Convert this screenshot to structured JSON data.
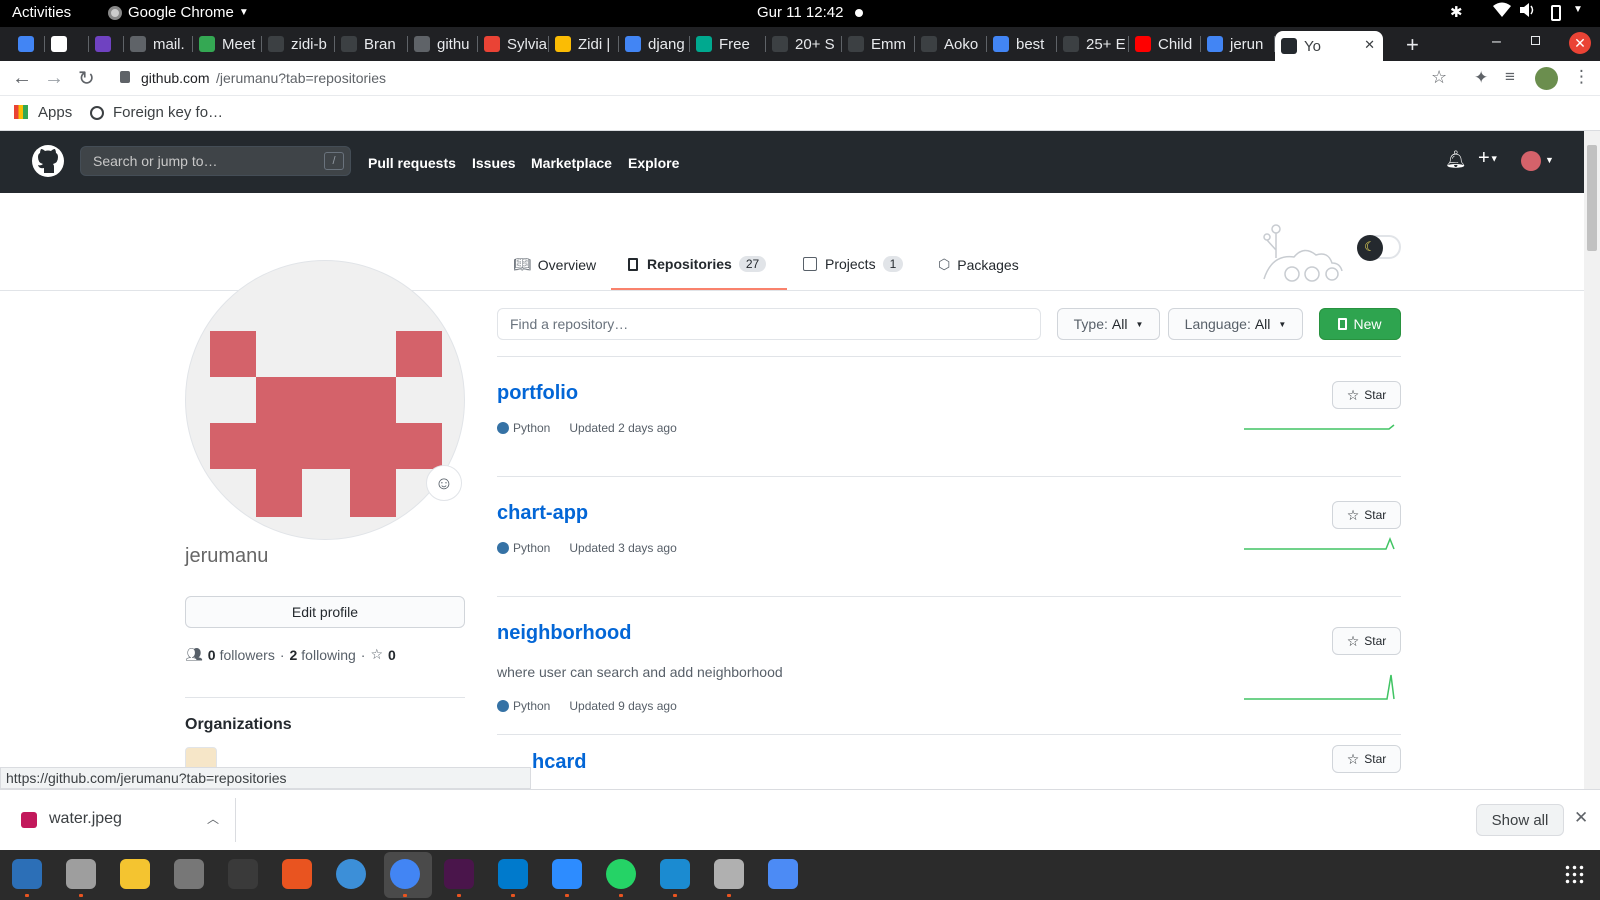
{
  "system": {
    "activities": "Activities",
    "app_name": "Google Chrome",
    "clock": "Gur 11  12:42"
  },
  "tabs": [
    {
      "label": "",
      "color": "#4285f4"
    },
    {
      "label": "",
      "color": "#ffffff"
    },
    {
      "label": "",
      "color": "#6f42c1"
    },
    {
      "label": "mail.",
      "color": "#5f6368"
    },
    {
      "label": "Meet",
      "color": "#34a853"
    },
    {
      "label": "zidi-b",
      "color": "#3c4043"
    },
    {
      "label": "Bran",
      "color": "#3c4043"
    },
    {
      "label": "githu",
      "color": "#5f6368"
    },
    {
      "label": "Sylvia",
      "color": "#ea4335"
    },
    {
      "label": "Zidi |",
      "color": "#fbbc04"
    },
    {
      "label": "djang",
      "color": "#4285f4"
    },
    {
      "label": "Free",
      "color": "#00a98f"
    },
    {
      "label": "20+ S",
      "color": "#3c4043"
    },
    {
      "label": "Emm",
      "color": "#3c4043"
    },
    {
      "label": "Aoko",
      "color": "#3c4043"
    },
    {
      "label": "best",
      "color": "#4285f4"
    },
    {
      "label": "25+ E",
      "color": "#3c4043"
    },
    {
      "label": "Child",
      "color": "#ff0000"
    },
    {
      "label": "jerun",
      "color": "#4285f4"
    },
    {
      "label": "Yo",
      "color": "#24292e"
    }
  ],
  "omnibox": {
    "url_host": "github.com",
    "url_path": "/jerumanu?tab=repositories"
  },
  "bookmarks": {
    "apps": "Apps",
    "item1": "Foreign key fo…"
  },
  "github_header": {
    "search_placeholder": "Search or jump to…",
    "search_key": "/",
    "nav": [
      "Pull requests",
      "Issues",
      "Marketplace",
      "Explore"
    ]
  },
  "profile": {
    "username": "jerumanu",
    "edit_profile": "Edit profile",
    "followers_count": "0",
    "followers_label": "followers",
    "following_count": "2",
    "following_label": "following",
    "stars_count": "0",
    "organizations_title": "Organizations",
    "avatar_color": "#d4626a"
  },
  "profile_tabs": [
    {
      "label": "Overview",
      "count": ""
    },
    {
      "label": "Repositories",
      "count": "27"
    },
    {
      "label": "Projects",
      "count": "1"
    },
    {
      "label": "Packages",
      "count": ""
    }
  ],
  "filters": {
    "find_placeholder": "Find a repository…",
    "type_label": "Type:",
    "type_value": "All",
    "language_label": "Language:",
    "language_value": "All",
    "new_label": "New"
  },
  "repos": [
    {
      "name": "portfolio",
      "description": "",
      "language": "Python",
      "updated": "Updated 2 days ago",
      "star": "Star"
    },
    {
      "name": "chart-app",
      "description": "",
      "language": "Python",
      "updated": "Updated 3 days ago",
      "star": "Star"
    },
    {
      "name": "neighborhood",
      "description": "where user can search and add neighborhood",
      "language": "Python",
      "updated": "Updated 9 days ago",
      "star": "Star"
    },
    {
      "name": "hcard",
      "description": "",
      "language": "",
      "updated": "",
      "star": "Star"
    }
  ],
  "status_url": "https://github.com/jerumanu?tab=repositories",
  "downloads": {
    "file": "water.jpeg",
    "show_all": "Show all"
  },
  "colors": {
    "accent_green": "#2ea44f",
    "link_blue": "#0366d6",
    "header_bg": "#24292e",
    "python": "#3572a5"
  }
}
